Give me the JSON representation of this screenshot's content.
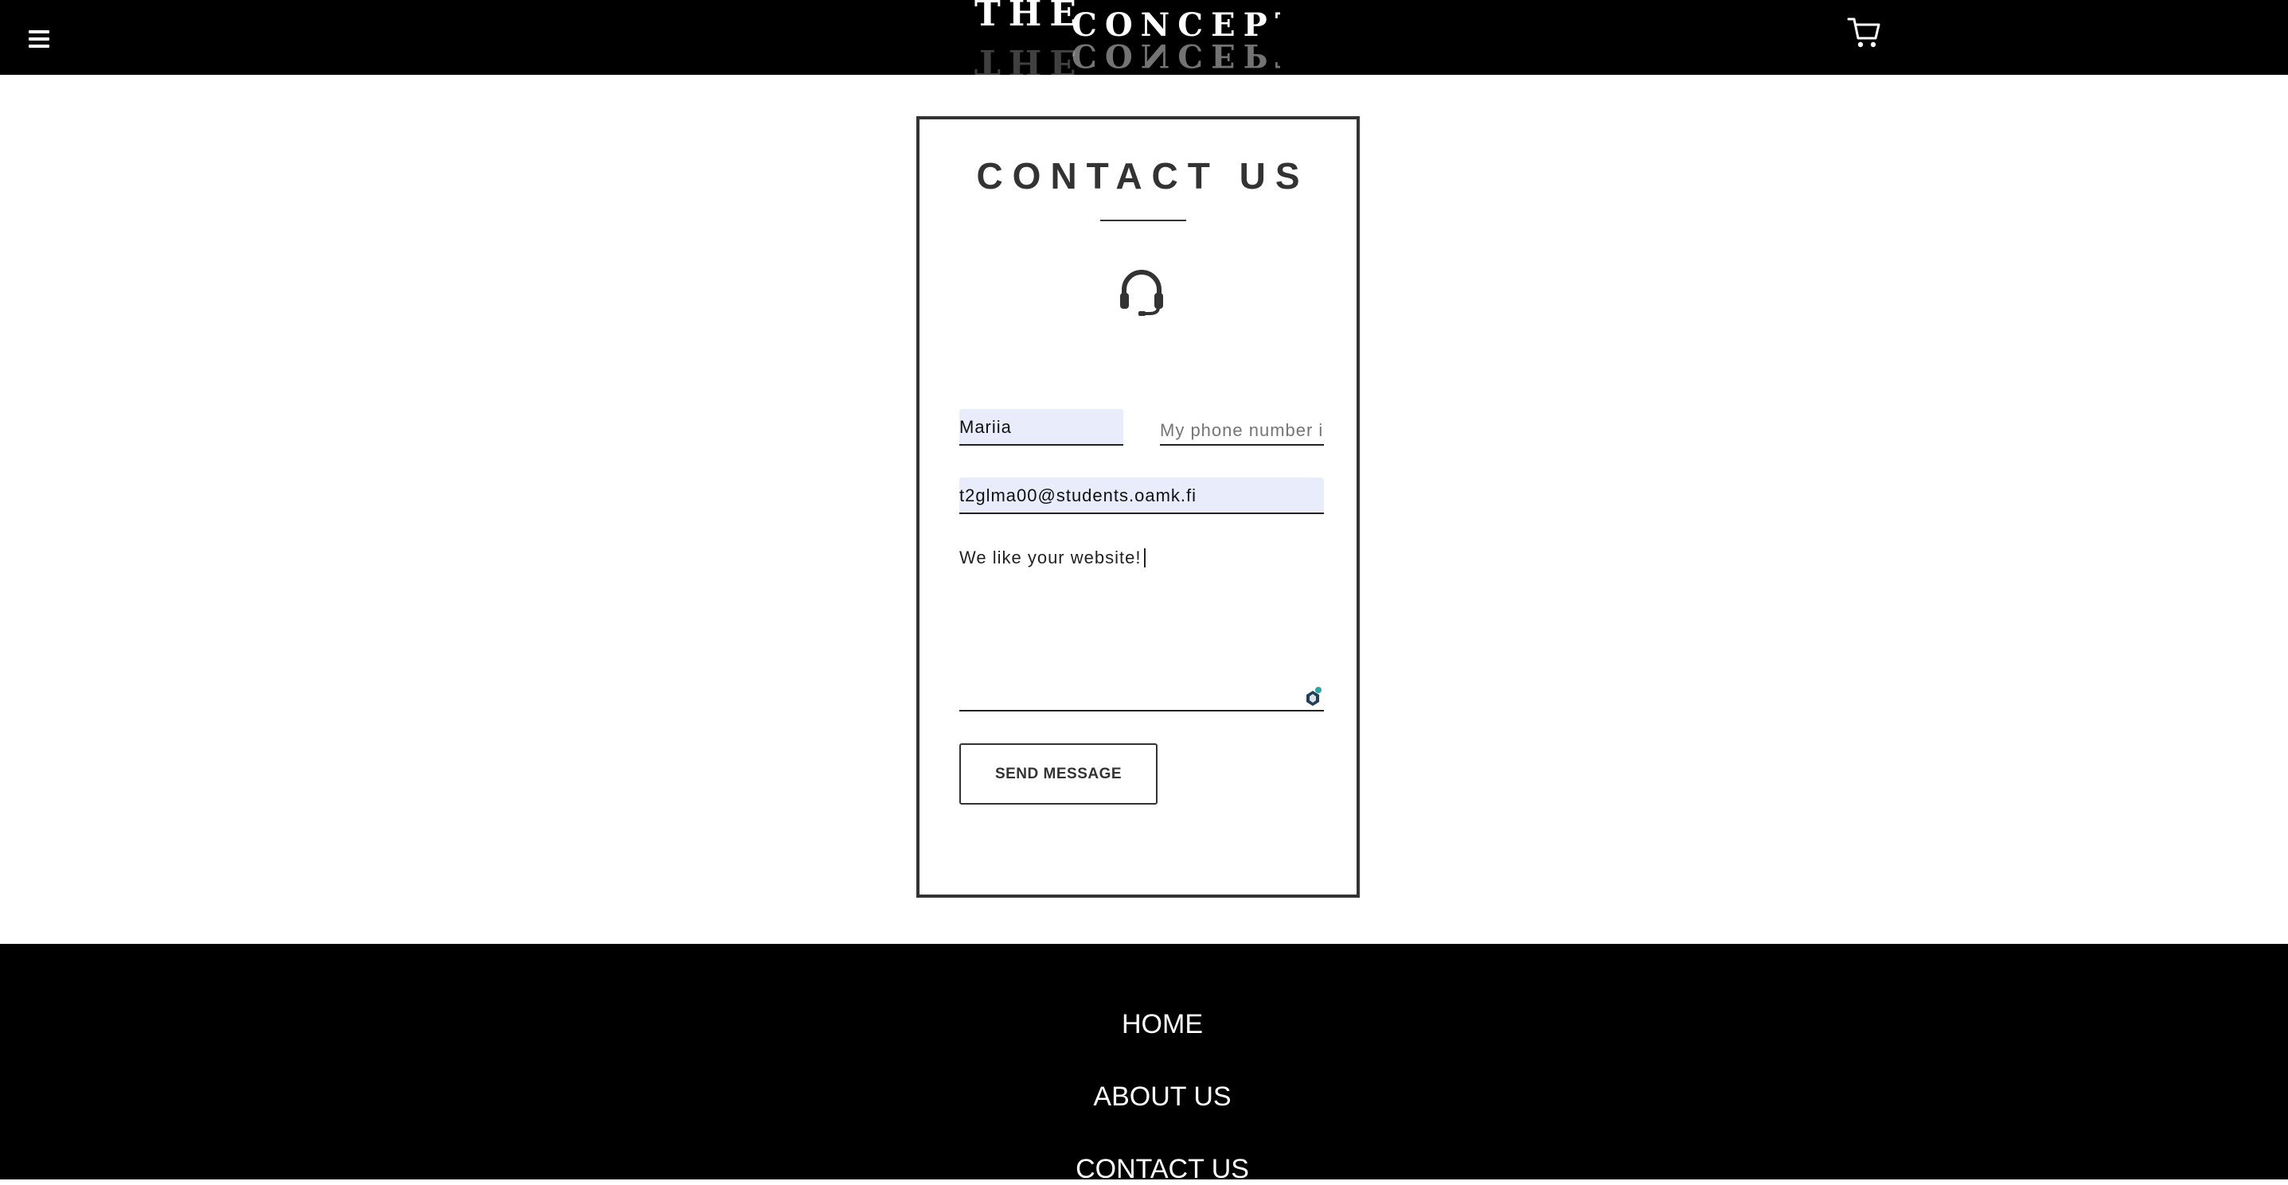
{
  "header": {
    "logo_the": "THE",
    "logo_concept": "CONCEPT",
    "menu_icon": "hamburger-menu-icon",
    "cart_icon": "shopping-cart-icon",
    "background": "#000000"
  },
  "contact": {
    "title": "CONTACT US",
    "icon": "headset-icon",
    "name_value": "Mariia",
    "phone_placeholder": "My phone number i",
    "email_value": "t2glma00@students.oamk.fi",
    "message_value": "We like your website!",
    "send_label": "SEND MESSAGE",
    "border_color": "#333333",
    "autofill_color": "#e8ecfb"
  },
  "footer": {
    "links": [
      {
        "label": "HOME"
      },
      {
        "label": "ABOUT US"
      },
      {
        "label": "CONTACT US"
      }
    ]
  }
}
